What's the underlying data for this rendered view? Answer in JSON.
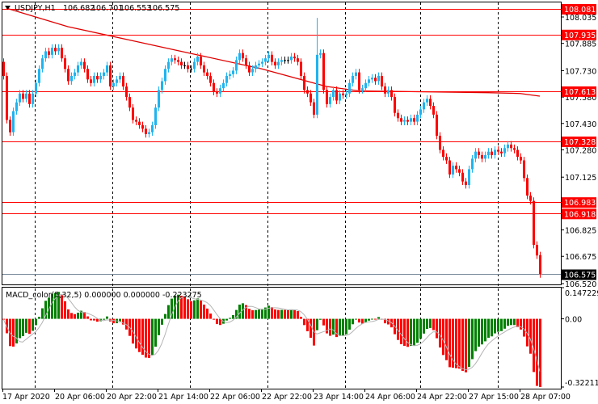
{
  "header": {
    "symbol": "USDJPY,H1",
    "open": "106.682",
    "high": "106.701",
    "low": "106.553",
    "close": "106.575"
  },
  "macd_label": "MACD_color(5,32,5) 0.000000 0.000000 -0.223275",
  "colors": {
    "bull": "#1EB4F0",
    "bear": "#FF0000",
    "doji": "#000000",
    "level": "#FF0000",
    "bid": "#778899",
    "macd_up": "#008000",
    "macd_down": "#FF0000",
    "signal": "#B4B4B4",
    "ma": "#E00000"
  },
  "chart_data": {
    "type": "candlestick",
    "title": "USDJPY,H1",
    "first_open": 107.78,
    "closes": [
      107.7,
      107.45,
      107.38,
      107.5,
      107.55,
      107.6,
      107.57,
      107.6,
      107.54,
      107.6,
      107.66,
      107.74,
      107.8,
      107.84,
      107.82,
      107.86,
      107.84,
      107.86,
      107.8,
      107.74,
      107.67,
      107.7,
      107.72,
      107.76,
      107.78,
      107.74,
      107.68,
      107.66,
      107.7,
      107.68,
      107.7,
      107.72,
      107.76,
      107.64,
      107.66,
      107.68,
      107.7,
      107.64,
      107.58,
      107.52,
      107.45,
      107.44,
      107.42,
      107.4,
      107.37,
      107.38,
      107.42,
      107.52,
      107.62,
      107.67,
      107.74,
      107.78,
      107.8,
      107.79,
      107.78,
      107.76,
      107.76,
      107.74,
      107.74,
      107.78,
      107.81,
      107.76,
      107.72,
      107.7,
      107.66,
      107.61,
      107.6,
      107.63,
      107.66,
      107.7,
      107.71,
      107.73,
      107.79,
      107.83,
      107.8,
      107.76,
      107.72,
      107.74,
      107.76,
      107.77,
      107.78,
      107.8,
      107.82,
      107.78,
      107.76,
      107.78,
      107.79,
      107.79,
      107.79,
      107.81,
      107.8,
      107.78,
      107.7,
      107.62,
      107.6,
      107.55,
      107.48,
      107.82,
      107.83,
      107.62,
      107.54,
      107.58,
      107.62,
      107.56,
      107.6,
      107.59,
      107.6,
      107.66,
      107.7,
      107.72,
      107.62,
      107.63,
      107.66,
      107.68,
      107.69,
      107.67,
      107.7,
      107.64,
      107.6,
      107.62,
      107.58,
      107.49,
      107.46,
      107.44,
      107.45,
      107.44,
      107.46,
      107.44,
      107.48,
      107.51,
      107.55,
      107.57,
      107.53,
      107.48,
      107.36,
      107.28,
      107.24,
      107.22,
      107.14,
      107.19,
      107.17,
      107.15,
      107.1,
      107.08,
      107.17,
      107.23,
      107.27,
      107.25,
      107.23,
      107.25,
      107.27,
      107.25,
      107.28,
      107.27,
      107.26,
      107.29,
      107.31,
      107.29,
      107.28,
      107.24,
      107.22,
      107.12,
      107.02,
      106.99,
      106.74,
      106.68,
      106.575
    ],
    "spike_highs": [
      [
        96,
        107.47
      ],
      [
        97,
        108.03
      ]
    ],
    "last_bar": {
      "open": 106.682,
      "high": 106.701,
      "low": 106.553,
      "close": 106.575
    },
    "moving_average": [
      [
        1,
        108.085
      ],
      [
        20,
        107.98
      ],
      [
        40,
        107.9
      ],
      [
        60,
        107.82
      ],
      [
        80,
        107.74
      ],
      [
        100,
        107.64
      ],
      [
        110,
        107.615
      ],
      [
        130,
        107.61
      ],
      [
        150,
        107.605
      ],
      [
        160,
        107.6
      ],
      [
        166,
        107.585
      ]
    ],
    "levels": [
      "108.081",
      "107.935",
      "107.613",
      "107.328",
      "106.983",
      "106.918"
    ],
    "bid": "106.575",
    "price_ticks": [
      "108.035",
      "107.885",
      "107.730",
      "107.580",
      "107.430",
      "107.280",
      "107.125",
      "106.825",
      "106.675",
      "106.520"
    ],
    "ylim": [
      106.52,
      108.035
    ],
    "macd": {
      "fast": 5,
      "slow": 32,
      "signal": 5,
      "ylim": [
        -0.322112,
        0.147229
      ],
      "ticks": [
        "0.147229",
        "0.00",
        "-0.322112"
      ]
    },
    "time_labels": [
      "17 Apr 2020",
      "20 Apr 06:00",
      "20 Apr 22:00",
      "21 Apr 14:00",
      "22 Apr 06:00",
      "22 Apr 22:00",
      "23 Apr 14:00",
      "24 Apr 06:00",
      "24 Apr 22:00",
      "27 Apr 15:00",
      "28 Apr 07:00"
    ]
  }
}
